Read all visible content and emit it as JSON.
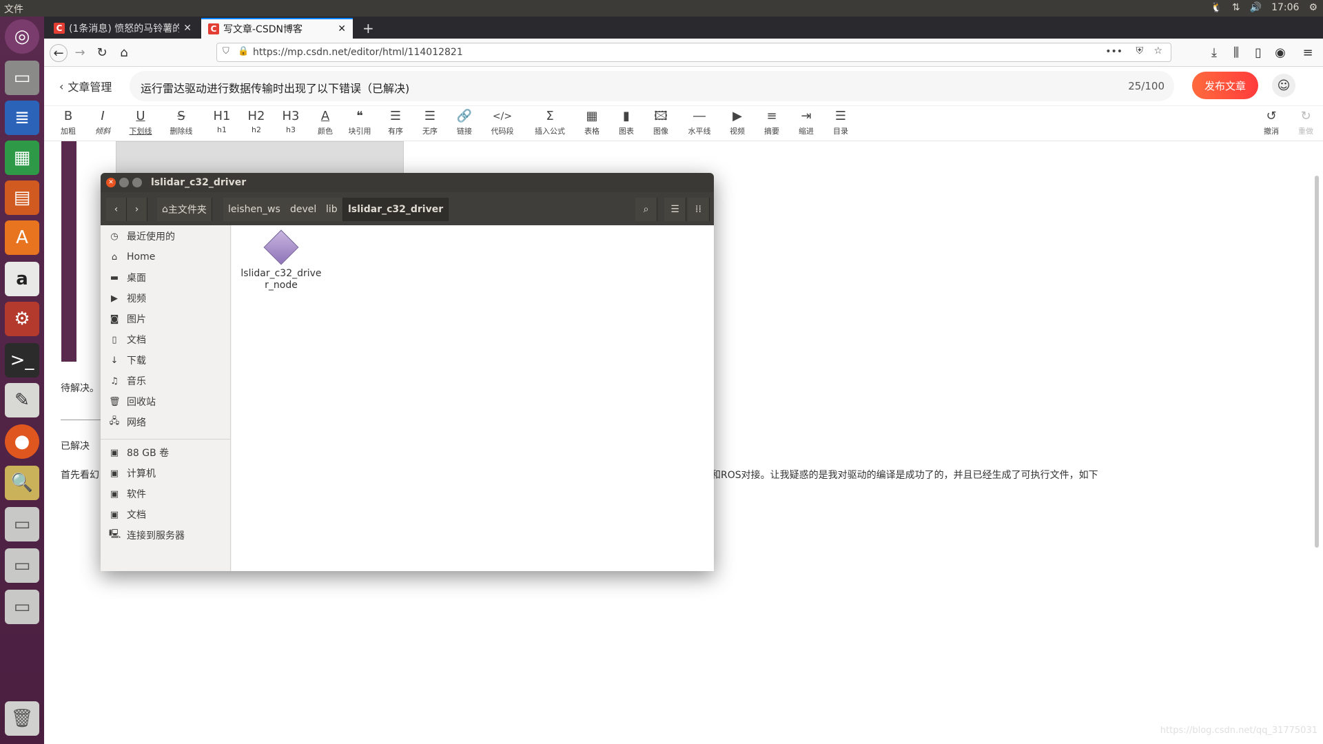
{
  "system": {
    "menu": "文件",
    "clock": "17:06"
  },
  "browser": {
    "tabs": [
      {
        "label": "(1条消息) 愤怒的马铃薯的",
        "favicon": "C"
      },
      {
        "label": "写文章-CSDN博客",
        "favicon": "C"
      }
    ],
    "url": "https://mp.csdn.net/editor/html/114012821"
  },
  "editor": {
    "back_label": "文章管理",
    "title": "运行雷达驱动进行数据传输时出现了以下错误（已解决)",
    "counter": "25/100",
    "publish_label": "发布文章",
    "toolbar": [
      {
        "icon": "B",
        "label": "加粗"
      },
      {
        "icon": "I",
        "label": "倾斜"
      },
      {
        "icon": "U",
        "label": "下划线"
      },
      {
        "icon": "S",
        "label": "删除线"
      },
      {
        "icon": "H1",
        "label": "h1"
      },
      {
        "icon": "H2",
        "label": "h2"
      },
      {
        "icon": "H3",
        "label": "h3"
      },
      {
        "icon": "A",
        "label": "颜色"
      },
      {
        "icon": "❝",
        "label": "块引用"
      },
      {
        "icon": "☰",
        "label": "有序"
      },
      {
        "icon": "☰",
        "label": "无序"
      },
      {
        "icon": "🔗",
        "label": "链接"
      },
      {
        "icon": "</>",
        "label": "代码段"
      },
      {
        "icon": "Σ",
        "label": "插入公式"
      },
      {
        "icon": "▦",
        "label": "表格"
      },
      {
        "icon": "▮",
        "label": "图表"
      },
      {
        "icon": "🖾",
        "label": "图像"
      },
      {
        "icon": "―",
        "label": "水平线"
      },
      {
        "icon": "▶",
        "label": "视频"
      },
      {
        "icon": "≡",
        "label": "摘要"
      },
      {
        "icon": "⇥",
        "label": "缩进"
      },
      {
        "icon": "☰",
        "label": "目录"
      }
    ],
    "undo_label": "撤消",
    "redo_label": "重做",
    "body": {
      "pending": "待解决。",
      "solved": "已解决",
      "para_left": "首先看幻",
      "para_right": "和ROS对接。让我疑惑的是我对驱动的编译是成功了的，并且已经生成了可执行文件，如下"
    },
    "watermark": "https://blog.csdn.net/qq_31775031"
  },
  "file_manager": {
    "title": "lslidar_c32_driver",
    "breadcrumbs": [
      "主文件夹",
      "leishen_ws",
      "devel",
      "lib",
      "lslidar_c32_driver"
    ],
    "sidebar": [
      {
        "icon": "clock",
        "label": "最近使用的"
      },
      {
        "icon": "home",
        "label": "Home"
      },
      {
        "icon": "folder",
        "label": "桌面"
      },
      {
        "icon": "video",
        "label": "视频"
      },
      {
        "icon": "camera",
        "label": "图片"
      },
      {
        "icon": "doc",
        "label": "文档"
      },
      {
        "icon": "download",
        "label": "下载"
      },
      {
        "icon": "music",
        "label": "音乐"
      },
      {
        "icon": "trash",
        "label": "回收站"
      },
      {
        "icon": "network",
        "label": "网络"
      }
    ],
    "devices": [
      {
        "icon": "drive",
        "label": "88 GB 卷"
      },
      {
        "icon": "drive",
        "label": "计算机"
      },
      {
        "icon": "drive",
        "label": "软件"
      },
      {
        "icon": "drive",
        "label": "文档"
      },
      {
        "icon": "server",
        "label": "连接到服务器"
      }
    ],
    "files": [
      {
        "name": "lslidar_c32_driver_node"
      }
    ]
  }
}
